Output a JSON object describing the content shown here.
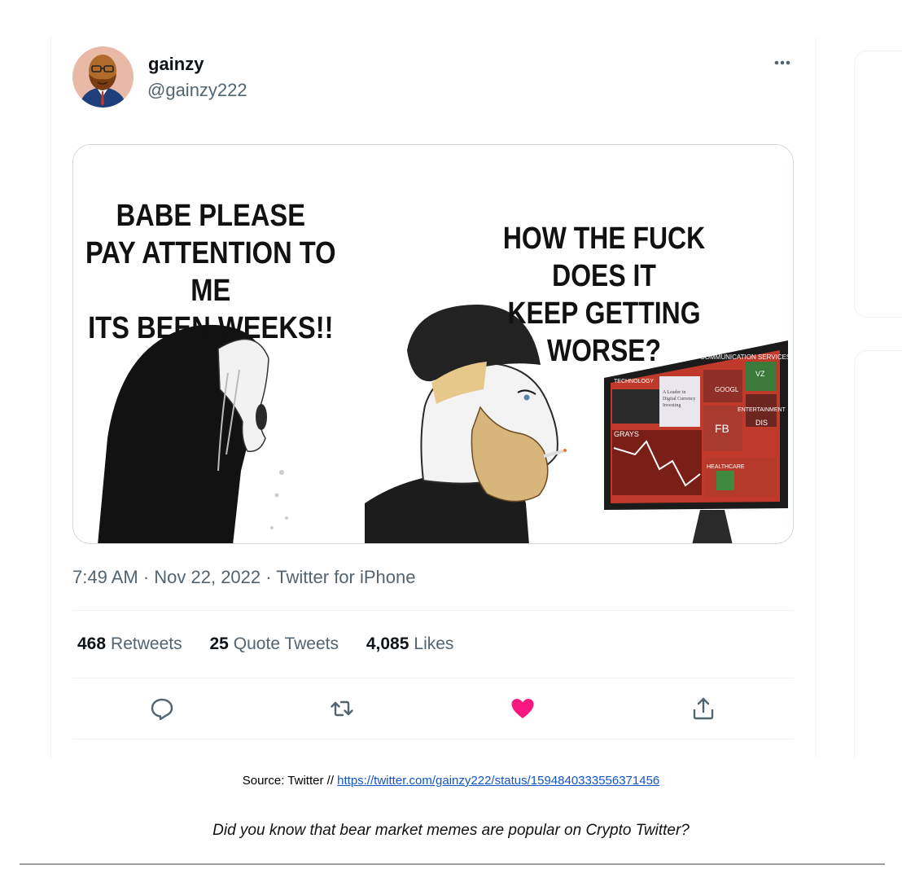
{
  "tweet": {
    "author_name": "gainzy",
    "author_handle": "@gainzy222",
    "media": {
      "left_text": [
        "BABE PLEASE",
        "PAY ATTENTION TO ME",
        "ITS BEEN WEEKS!!"
      ],
      "right_text": [
        "HOW THE FUCK DOES IT",
        "KEEP GETTING WORSE?"
      ],
      "monitor_labels": {
        "technology": "TECHNOLOGY",
        "communication": "COMMUNICATION SERVICES",
        "googl": "GOOGL",
        "vz": "VZ",
        "fb": "FB",
        "dis": "DIS",
        "entertainment": "ENTERTAINMENT",
        "healthcare": "HEALTHCARE",
        "grayscale": "GRAYS",
        "note": "A Leader in Digital Currency Investing"
      }
    },
    "timestamp": "7:49 AM · Nov 22, 2022 · Twitter for iPhone",
    "stats": {
      "retweets_count": "468",
      "retweets_label": "Retweets",
      "quotes_count": "25",
      "quotes_label": "Quote Tweets",
      "likes_count": "4,085",
      "likes_label": "Likes"
    },
    "actions": {
      "reply_icon": "reply-icon",
      "retweet_icon": "retweet-icon",
      "like_icon": "heart-icon",
      "share_icon": "share-icon",
      "like_color": "#f91880"
    }
  },
  "caption": {
    "source_prefix": "Source: Twitter // ",
    "source_link": "https://twitter.com/gainzy222/status/1594840333556371456",
    "note": "Did you know that bear market memes are popular on Crypto Twitter?"
  }
}
